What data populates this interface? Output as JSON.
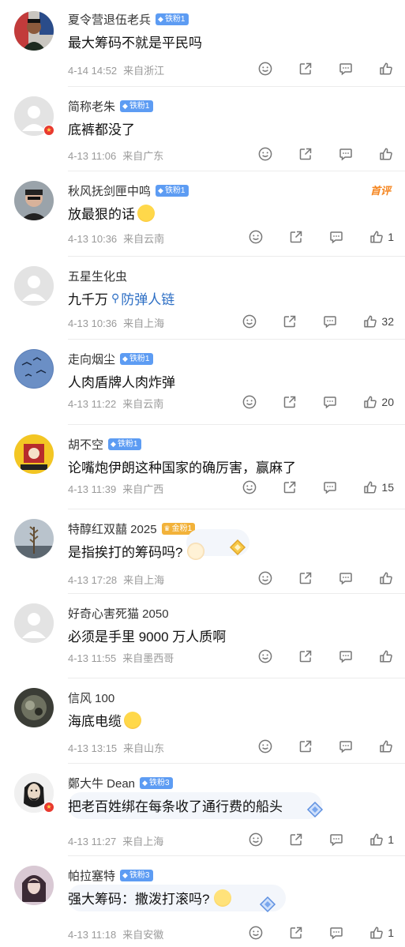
{
  "icons": [
    "smile-icon",
    "share-icon",
    "comment-icon",
    "like-icon"
  ],
  "comments": [
    {
      "name": "夏令营退伍老兵",
      "fan": "铁粉1",
      "text": "最大筹码不就是平民吗",
      "date": "4-14 14:52",
      "location": "来自浙江",
      "likes": ""
    },
    {
      "name": "简称老朱",
      "fan": "铁粉1",
      "text": "底裤都没了",
      "date": "4-13 11:06",
      "location": "来自广东",
      "likes": ""
    },
    {
      "name": "秋风抚剑匣中鸣",
      "fan": "铁粉1",
      "text": "放最狠的话",
      "date": "4-13 10:36",
      "location": "来自云南",
      "likes": "1",
      "hot": "首评"
    },
    {
      "name": "五星生化虫",
      "fan": "",
      "text": "九千万",
      "link": "防弹人链",
      "date": "4-13 10:36",
      "location": "来自上海",
      "likes": "32"
    },
    {
      "name": "走向烟尘",
      "fan": "铁粉1",
      "text": "人肉盾牌人肉炸弹",
      "date": "4-13 11:22",
      "location": "来自云南",
      "likes": "20"
    },
    {
      "name": "胡不空",
      "fan": "铁粉1",
      "text": "论嘴炮伊朗这种国家的确厉害，赢麻了",
      "date": "4-13 11:39",
      "location": "来自广西",
      "likes": "15"
    },
    {
      "name": "特醇红双囍 2025",
      "fan": "金粉1",
      "text": "是指挨打的筹码吗?",
      "date": "4-13 17:28",
      "location": "来自上海",
      "likes": ""
    },
    {
      "name": "好奇心害死猫 2050",
      "fan": "",
      "text": "必须是手里 9000 万人质啊",
      "date": "4-13 11:55",
      "location": "来自墨西哥",
      "likes": ""
    },
    {
      "name": "信风 100",
      "fan": "",
      "text": "海底电缆",
      "date": "4-13 13:15",
      "location": "来自山东",
      "likes": ""
    },
    {
      "name": "鄭大牛 Dean",
      "fan": "铁粉3",
      "text": "把老百姓绑在每条收了通行费的船头",
      "date": "4-13 11:27",
      "location": "来自上海",
      "likes": "1"
    },
    {
      "name": "帕拉塞特",
      "fan": "铁粉3",
      "text": "强大筹码：撒泼打滚吗?",
      "date": "4-13 11:18",
      "location": "来自安徽",
      "likes": "1"
    }
  ]
}
